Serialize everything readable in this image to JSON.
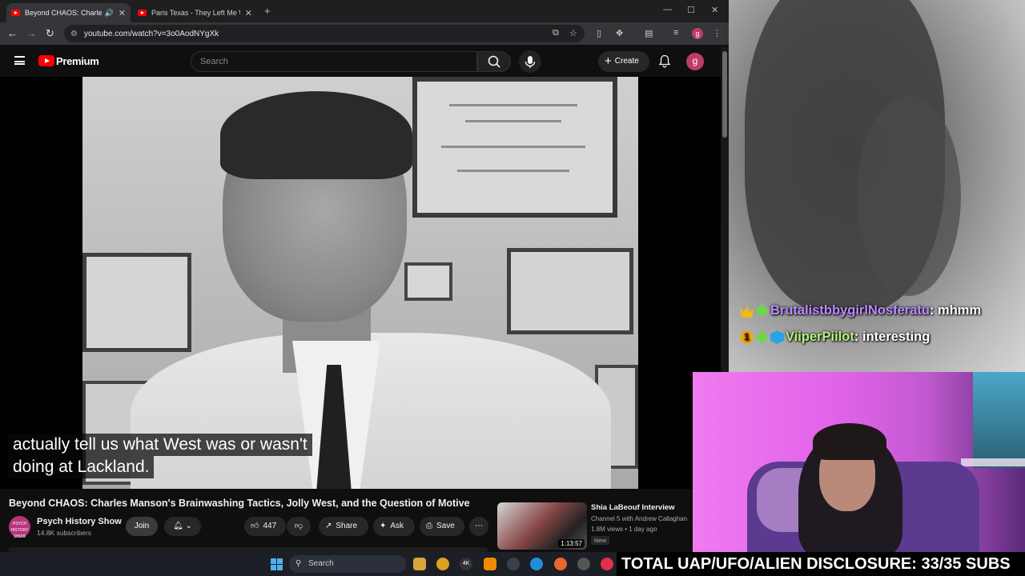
{
  "browser": {
    "tabs": [
      {
        "title": "Beyond CHAOS: Charles M",
        "active": true
      },
      {
        "title": "Paris Texas - They Left Me With",
        "active": false
      }
    ],
    "url": "youtube.com/watch?v=3o0AodNYgXk"
  },
  "youtube": {
    "premium_label": "Premium",
    "search_placeholder": "Search",
    "create_label": "Create",
    "avatar_letter": "g"
  },
  "video": {
    "caption_line1": "actually tell us what West was or wasn't",
    "caption_line2": "doing at Lackland.",
    "title": "Beyond CHAOS: Charles Manson's Brainwashing Tactics, Jolly West, and the Question of Motive",
    "channel": "Psych History Show",
    "subscribers": "14.8K subscribers",
    "join_label": "Join",
    "likes": "447",
    "share_label": "Share",
    "ask_label": "Ask",
    "save_label": "Save"
  },
  "recommendation": {
    "title": "Shia LaBeouf Interview",
    "channel": "Channel 5 with Andrew Callaghan",
    "meta": "1.8M views • 1 day ago",
    "badge": "New",
    "duration": "1:13:57"
  },
  "taskbar": {
    "search_label": "Search"
  },
  "stream": {
    "chat": [
      {
        "user": "BrutalistbbygirlNosferatu",
        "message": "mhmm",
        "user_color": "#b98bff"
      },
      {
        "user": "ViiperPiilot",
        "message": "interesting",
        "user_color": "#b6f07a"
      }
    ],
    "banner": "TOTAL UAP/UFO/ALIEN DISCLOSURE: 33/35 SUBS"
  }
}
